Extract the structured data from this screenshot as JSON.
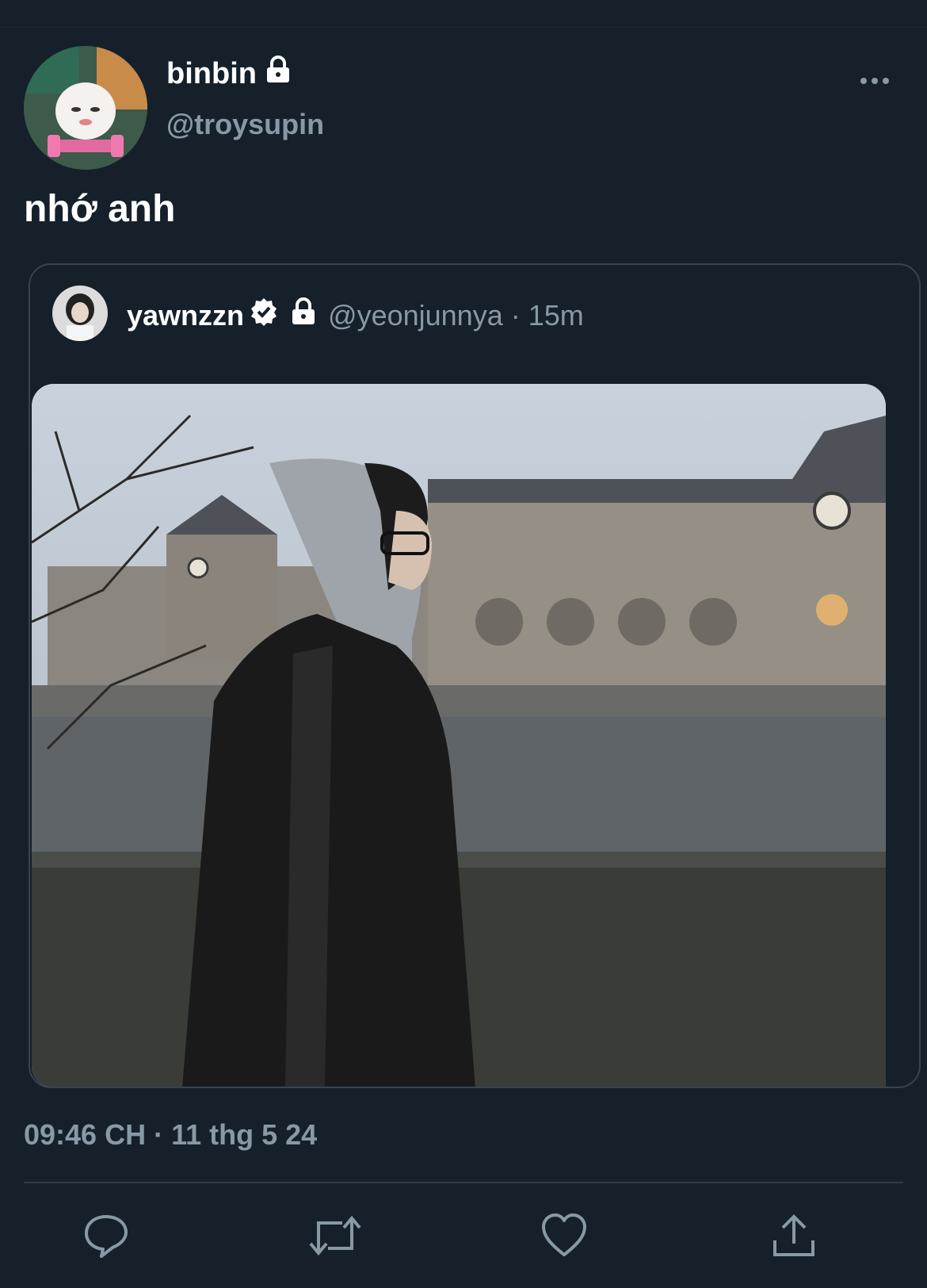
{
  "author": {
    "display_name": "binbin",
    "handle": "@troysupin",
    "protected": true
  },
  "tweet": {
    "text": "nhớ anh",
    "timestamp": "09:46 CH · 11 thg 5 24"
  },
  "quoted_tweet": {
    "display_name": "yawnzzn",
    "verified": true,
    "protected": true,
    "handle": "@yeonjunnya",
    "time": "15m"
  },
  "icons": {
    "lock": "lock-icon",
    "verified": "verified-badge-icon",
    "more": "more-horizontal-icon",
    "reply": "reply-icon",
    "retweet": "retweet-icon",
    "like": "heart-icon",
    "share": "share-icon"
  },
  "colors": {
    "background": "#15202b",
    "secondary_text": "#8899a6",
    "border": "#38444d"
  }
}
